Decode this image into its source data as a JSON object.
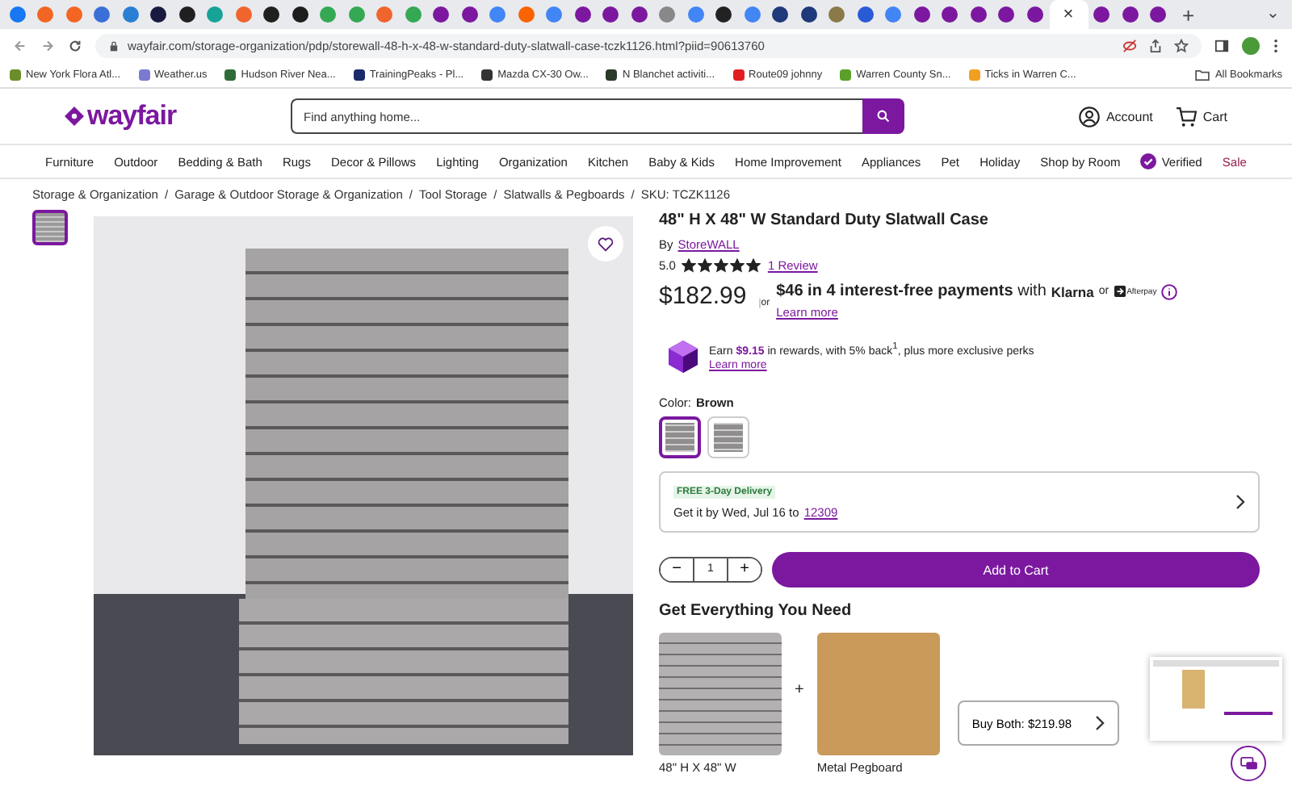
{
  "browser": {
    "tabs": [
      {
        "color": "#1877f2",
        "selected": false
      },
      {
        "color": "#f26522",
        "selected": false
      },
      {
        "color": "#f26522",
        "selected": false
      },
      {
        "color": "#3b6fd8",
        "selected": false
      },
      {
        "color": "#2a7fd4",
        "selected": false
      },
      {
        "color": "#1a1a40",
        "selected": false
      },
      {
        "color": "#202020",
        "selected": false
      },
      {
        "color": "#17a398",
        "selected": false
      },
      {
        "color": "#f0642d",
        "selected": false
      },
      {
        "color": "#202020",
        "selected": false
      },
      {
        "color": "#1d1d1d",
        "selected": false
      },
      {
        "color": "#34a853",
        "selected": false
      },
      {
        "color": "#34a853",
        "selected": false
      },
      {
        "color": "#f0642d",
        "selected": false
      },
      {
        "color": "#34a853",
        "selected": false
      },
      {
        "color": "#7b189f",
        "selected": false
      },
      {
        "color": "#7b189f",
        "selected": false
      },
      {
        "color": "#4285f4",
        "selected": false
      },
      {
        "color": "#f96302",
        "selected": false
      },
      {
        "color": "#4285f4",
        "selected": false
      },
      {
        "color": "#7b189f",
        "selected": false
      },
      {
        "color": "#7b189f",
        "selected": false
      },
      {
        "color": "#7b189f",
        "selected": false
      },
      {
        "color": "#888888",
        "selected": false
      },
      {
        "color": "#4285f4",
        "selected": false
      },
      {
        "color": "#222222",
        "selected": false
      },
      {
        "color": "#4285f4",
        "selected": false
      },
      {
        "color": "#1f3a7a",
        "selected": false
      },
      {
        "color": "#1f3a7a",
        "selected": false
      },
      {
        "color": "#8a7a4a",
        "selected": false
      },
      {
        "color": "#2a5bd7",
        "selected": false
      },
      {
        "color": "#4285f4",
        "selected": false
      },
      {
        "color": "#7b189f",
        "selected": false
      },
      {
        "color": "#7b189f",
        "selected": false
      },
      {
        "color": "#7b189f",
        "selected": false
      },
      {
        "color": "#7b189f",
        "selected": false
      },
      {
        "color": "#7b189f",
        "selected": false
      },
      {
        "selected": true
      },
      {
        "color": "#7b189f",
        "selected": false
      },
      {
        "color": "#7b189f",
        "selected": false
      },
      {
        "color": "#7b189f",
        "selected": false
      }
    ],
    "tab_close": "×",
    "new_tab": "+",
    "tab_menu": "⌄",
    "url": "wayfair.com/storage-organization/pdp/storewall-48-h-x-48-w-standard-duty-slatwall-case-tczk1126.html?piid=90613760",
    "bookmarks": [
      {
        "label": "New York Flora Atl...",
        "color": "#6a8f2a"
      },
      {
        "label": "Weather.us",
        "color": "#7a7ad0"
      },
      {
        "label": "Hudson River Nea...",
        "color": "#2e6b3a"
      },
      {
        "label": "TrainingPeaks - Pl...",
        "color": "#1a2a6a"
      },
      {
        "label": "Mazda CX-30 Ow...",
        "color": "#333333"
      },
      {
        "label": "N Blanchet activiti...",
        "color": "#2a3a2a"
      },
      {
        "label": "Route09 johnny",
        "color": "#e02020"
      },
      {
        "label": "Warren County Sn...",
        "color": "#5aa02a"
      },
      {
        "label": "Ticks in Warren C...",
        "color": "#f0a020"
      }
    ],
    "all_bookmarks": "All Bookmarks"
  },
  "header": {
    "logo": "wayfair",
    "search": {
      "placeholder": "Find anything home..."
    },
    "account": "Account",
    "cart": "Cart"
  },
  "nav": [
    {
      "label": "Furniture",
      "kind": "plain"
    },
    {
      "label": "Outdoor",
      "kind": "plain"
    },
    {
      "label": "Bedding & Bath",
      "kind": "plain"
    },
    {
      "label": "Rugs",
      "kind": "plain"
    },
    {
      "label": "Decor & Pillows",
      "kind": "plain"
    },
    {
      "label": "Lighting",
      "kind": "plain"
    },
    {
      "label": "Organization",
      "kind": "plain"
    },
    {
      "label": "Kitchen",
      "kind": "plain"
    },
    {
      "label": "Baby & Kids",
      "kind": "plain"
    },
    {
      "label": "Home Improvement",
      "kind": "plain"
    },
    {
      "label": "Appliances",
      "kind": "plain"
    },
    {
      "label": "Pet",
      "kind": "plain"
    },
    {
      "label": "Holiday",
      "kind": "plain"
    },
    {
      "label": "Shop by Room",
      "kind": "plain"
    },
    {
      "label": "Verified",
      "kind": "verified"
    },
    {
      "label": "Sale",
      "kind": "sale"
    }
  ],
  "breadcrumb": {
    "separator": "/",
    "items": [
      "Storage & Organization",
      "Garage & Outdoor Storage & Organization",
      "Tool Storage",
      "Slatwalls & Pegboards",
      "SKU: TCZK1126"
    ]
  },
  "gallery": {
    "thumbnails": [
      {
        "selected": true
      }
    ]
  },
  "product": {
    "title": "48\" H X 48\" W Standard Duty Slatwall Case",
    "by": "By",
    "brand": "StoreWALL",
    "rating": "5.0",
    "stars": 5,
    "reviews": "1 Review",
    "price": "$182.99",
    "or": "or",
    "installment": "**$46 in 4 interest-free payments** with",
    "klarna": "Klarna",
    "or2": "or",
    "afterpay": "Afterpay",
    "learn_more": "Learn more",
    "rewards": "Earn **$9.15** in rewards, with 5% back$^{1}$, plus more exclusive perks",
    "rewards_link": "Learn more",
    "color_label": "Color:",
    "color_value": "Brown",
    "swatches": [
      {
        "selected": true
      },
      {
        "selected": false
      }
    ],
    "delivery": {
      "badge": "FREE 3-Day Delivery",
      "text": "Get it by Wed, Jul 16 to",
      "zip": "12309"
    },
    "quantity": {
      "minus": "−",
      "value": "1",
      "plus": "+"
    },
    "add_to_cart": "Add to Cart"
  },
  "bundle": {
    "title": "Get Everything You Need",
    "items": [
      {
        "caption": "48\" H X 48\" W",
        "kind": "slatwall"
      },
      {
        "caption": "Metal Pegboard",
        "kind": "pegboard"
      }
    ],
    "plus": "+",
    "buy_both": "Buy Both: $219.98"
  }
}
